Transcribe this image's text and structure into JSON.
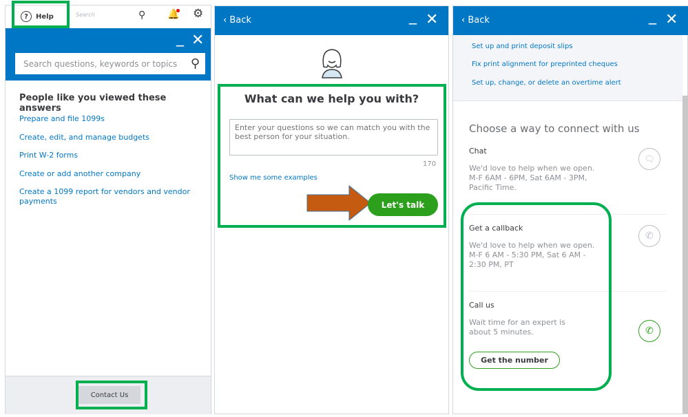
{
  "topbar": {
    "help_label": "Help",
    "search_placeholder": "Search"
  },
  "panel1": {
    "search_placeholder": "Search questions, keywords or topics",
    "heading": "People like you viewed these answers",
    "answers": [
      "Prepare and file 1099s",
      "Create, edit, and manage budgets",
      "Print W-2 forms",
      "Create or add another company",
      "Create a 1099 report for vendors and vendor payments"
    ],
    "contact_label": "Contact Us"
  },
  "panel2": {
    "back_label": "Back",
    "heading": "What can we help you with?",
    "textarea_placeholder": "Enter your questions so we can match you with the best person for your situation.",
    "char_count": "170",
    "examples_link": "Show me some examples",
    "talk_label": "Let's talk"
  },
  "panel3": {
    "back_label": "Back",
    "links": [
      "Set up and print deposit slips",
      "Fix print alignment for preprinted cheques",
      "Set up, change, or delete an overtime alert"
    ],
    "heading": "Choose a way to connect with us",
    "options": [
      {
        "title": "Chat",
        "desc": "We'd love to help when we open. M-F 6AM - 6PM, Sat 6AM - 3PM, Pacific Time."
      },
      {
        "title": "Get a callback",
        "desc": "We'd love to help when we open. M-F 6 AM - 5:30 PM, Sat 6 AM - 2:30 PM, PT"
      },
      {
        "title": "Call us",
        "desc": "Wait time for an expert is about 5 minutes."
      }
    ],
    "number_label": "Get the number"
  },
  "colors": {
    "brand_blue": "#0077c5",
    "green": "#2ca01c",
    "highlight": "#00b050",
    "arrow": "#c55a11"
  }
}
